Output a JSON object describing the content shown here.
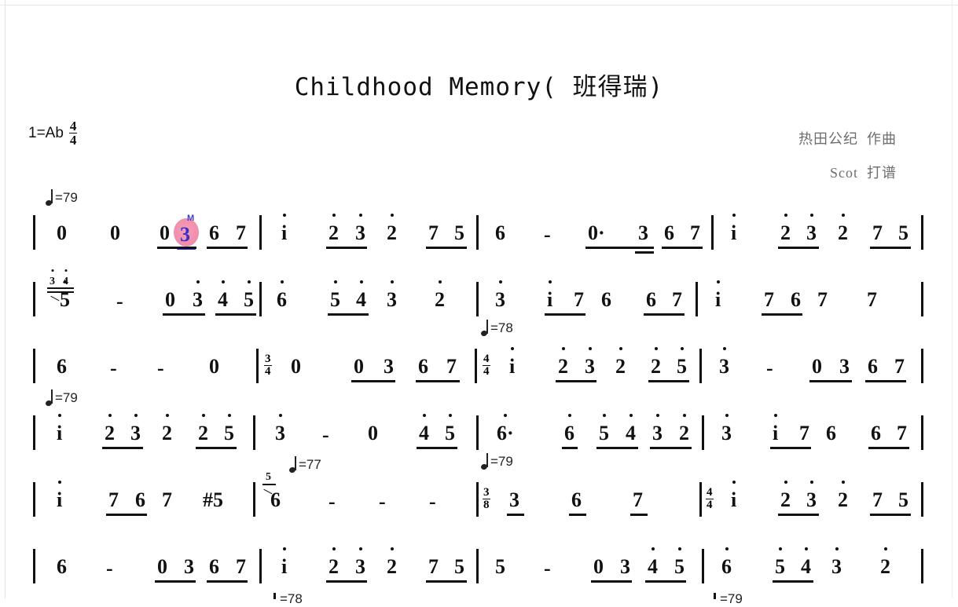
{
  "document": {
    "title": "Childhood Memory( 班得瑞)",
    "key_signature": "1=Ab",
    "time_signature": {
      "num": "4",
      "den": "4"
    },
    "composer": "热田公纪  作曲",
    "engraver": "Scot  打谱",
    "notation_type": "jianpu-numbered-musical-notation"
  },
  "playback": {
    "active_note": "3",
    "marker_label": "M",
    "highlight_color": "#f08aa8",
    "marker_color": "#3a3ad8",
    "underline_color": "#2b2bd0"
  },
  "tempo_marks": [
    {
      "id": "t1",
      "value": "=79"
    },
    {
      "id": "t2",
      "value": "=78"
    },
    {
      "id": "t3",
      "value": "=79"
    },
    {
      "id": "t4",
      "value": "=77"
    },
    {
      "id": "t5",
      "value": "=79"
    },
    {
      "id": "t6",
      "value": "=78"
    },
    {
      "id": "t7",
      "value": "=79"
    }
  ],
  "time_changes": [
    {
      "num": "3",
      "den": "4"
    },
    {
      "num": "4",
      "den": "4"
    },
    {
      "num": "3",
      "den": "8"
    },
    {
      "num": "4",
      "den": "4"
    }
  ],
  "systems": [
    {
      "id": "system-1",
      "measures": [
        {
          "id": "m1",
          "notes": [
            "0",
            "0",
            "0",
            "3",
            "6",
            "7"
          ]
        },
        {
          "id": "m2",
          "notes": [
            "i",
            "2",
            "3",
            "2",
            "7",
            "5"
          ]
        },
        {
          "id": "m3",
          "notes": [
            "6",
            "-",
            "0·",
            "3",
            "6",
            "7"
          ]
        },
        {
          "id": "m4",
          "notes": [
            "i",
            "2",
            "3",
            "2",
            "7",
            "5"
          ]
        }
      ]
    },
    {
      "id": "system-2",
      "measures": [
        {
          "id": "m5",
          "notes": [
            "3",
            "4",
            "5",
            "-",
            "0",
            "3",
            "4",
            "5"
          ]
        },
        {
          "id": "m6",
          "notes": [
            "6",
            "5",
            "4",
            "3",
            "2"
          ]
        },
        {
          "id": "m7",
          "notes": [
            "3",
            "i",
            "7",
            "6",
            "6",
            "7"
          ]
        },
        {
          "id": "m8",
          "notes": [
            "i",
            "7",
            "6",
            "7",
            "7"
          ]
        }
      ]
    },
    {
      "id": "system-3",
      "measures": [
        {
          "id": "m9",
          "notes": [
            "6",
            "-",
            "-",
            "0"
          ]
        },
        {
          "id": "m10",
          "notes": [
            "0",
            "0",
            "3",
            "6",
            "7"
          ]
        },
        {
          "id": "m11",
          "notes": [
            "i",
            "2",
            "3",
            "2",
            "2",
            "5"
          ]
        },
        {
          "id": "m12",
          "notes": [
            "3",
            "-",
            "0",
            "3",
            "6",
            "7"
          ]
        }
      ]
    },
    {
      "id": "system-4",
      "measures": [
        {
          "id": "m13",
          "notes": [
            "i",
            "2",
            "3",
            "2",
            "2",
            "5"
          ]
        },
        {
          "id": "m14",
          "notes": [
            "3",
            "-",
            "0",
            "4",
            "5"
          ]
        },
        {
          "id": "m15",
          "notes": [
            "6·",
            "6",
            "5",
            "4",
            "3",
            "2"
          ]
        },
        {
          "id": "m16",
          "notes": [
            "3",
            "i",
            "7",
            "6",
            "6",
            "7"
          ]
        }
      ]
    },
    {
      "id": "system-5",
      "measures": [
        {
          "id": "m17",
          "notes": [
            "i",
            "7",
            "6",
            "7",
            "#5"
          ]
        },
        {
          "id": "m18",
          "notes": [
            "5",
            "6",
            "-",
            "-",
            "-"
          ]
        },
        {
          "id": "m19",
          "notes": [
            "3",
            "6",
            "7"
          ]
        },
        {
          "id": "m20",
          "notes": [
            "i",
            "2",
            "3",
            "2",
            "7",
            "5"
          ]
        }
      ]
    },
    {
      "id": "system-6",
      "measures": [
        {
          "id": "m21",
          "notes": [
            "6",
            "-",
            "0",
            "3",
            "6",
            "7"
          ]
        },
        {
          "id": "m22",
          "notes": [
            "i",
            "2",
            "3",
            "2",
            "7",
            "5"
          ]
        },
        {
          "id": "m23",
          "notes": [
            "5",
            "-",
            "0",
            "3",
            "4",
            "5"
          ]
        },
        {
          "id": "m24",
          "notes": [
            "6",
            "5",
            "4",
            "3",
            "2"
          ]
        }
      ]
    }
  ]
}
